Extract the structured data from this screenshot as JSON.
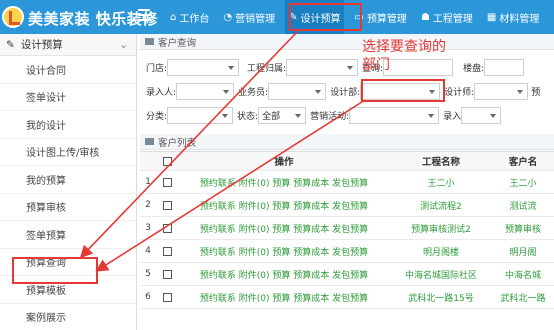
{
  "header": {
    "brand": "美美家装 快乐装修",
    "nav": [
      {
        "label": "工作台",
        "icon": "home-icon"
      },
      {
        "label": "营销管理",
        "icon": "chat-icon"
      },
      {
        "label": "设计预算",
        "icon": "edit-icon"
      },
      {
        "label": "预算管理",
        "icon": "monitor-icon"
      },
      {
        "label": "工程管理",
        "icon": "people-icon"
      },
      {
        "label": "材料管理",
        "icon": "grid-icon"
      }
    ]
  },
  "sidebar": {
    "section": "设计预算",
    "items": [
      "设计合同",
      "签单设计",
      "我的设计",
      "设计图上传/审核",
      "我的预算",
      "预算审核",
      "签单预算",
      "预算查询",
      "预算模板",
      "案例展示"
    ]
  },
  "query": {
    "title": "客户查询",
    "row1": {
      "store_label": "门店:",
      "ownership_label": "工程归属:",
      "query_label": "查询:",
      "estate_label": "楼盘:"
    },
    "row2": {
      "entry_label": "录入人:",
      "salesman_label": "业务员:",
      "design_dept_label": "设计部:",
      "designer_label": "设计师:",
      "budget_label": "预"
    },
    "row3": {
      "category_label": "分类:",
      "status_label": "状态:",
      "status_value": "全部",
      "campaign_label": "营销活动:",
      "entry2_label": "录入"
    }
  },
  "annotation": {
    "line1": "选择要查询的",
    "line2": "部门"
  },
  "list": {
    "title": "客户列表",
    "columns": {
      "op": "操作",
      "name": "工程名称",
      "customer": "客户名"
    },
    "rows": [
      {
        "num": "1",
        "op": "预约联系 附件(0) 预算 预算成本 发包预算",
        "name": "王二小",
        "customer": "王二小"
      },
      {
        "num": "2",
        "op": "预约联系 附件(0) 预算 预算成本 发包预算",
        "name": "测试流程2",
        "customer": "测试流"
      },
      {
        "num": "3",
        "op": "预约联系 附件(0) 预算 预算成本 发包预算",
        "name": "预算审核测试2",
        "customer": "预算审核"
      },
      {
        "num": "4",
        "op": "预约联系 附件(0) 预算 预算成本 发包预算",
        "name": "明月阁楼",
        "customer": "明月阁"
      },
      {
        "num": "5",
        "op": "预约联系 附件(0) 预算 预算成本 发包预算",
        "name": "中海名城国际社区",
        "customer": "中海名城"
      },
      {
        "num": "6",
        "op": "预约联系 附件(0) 预算 预算成本 发包预算",
        "name": "武科北一路15号",
        "customer": "武科北一路"
      }
    ]
  },
  "colors": {
    "topbar": "#2b97d9",
    "link_green": "#2e9c3a",
    "annotation_red": "#e53935"
  }
}
